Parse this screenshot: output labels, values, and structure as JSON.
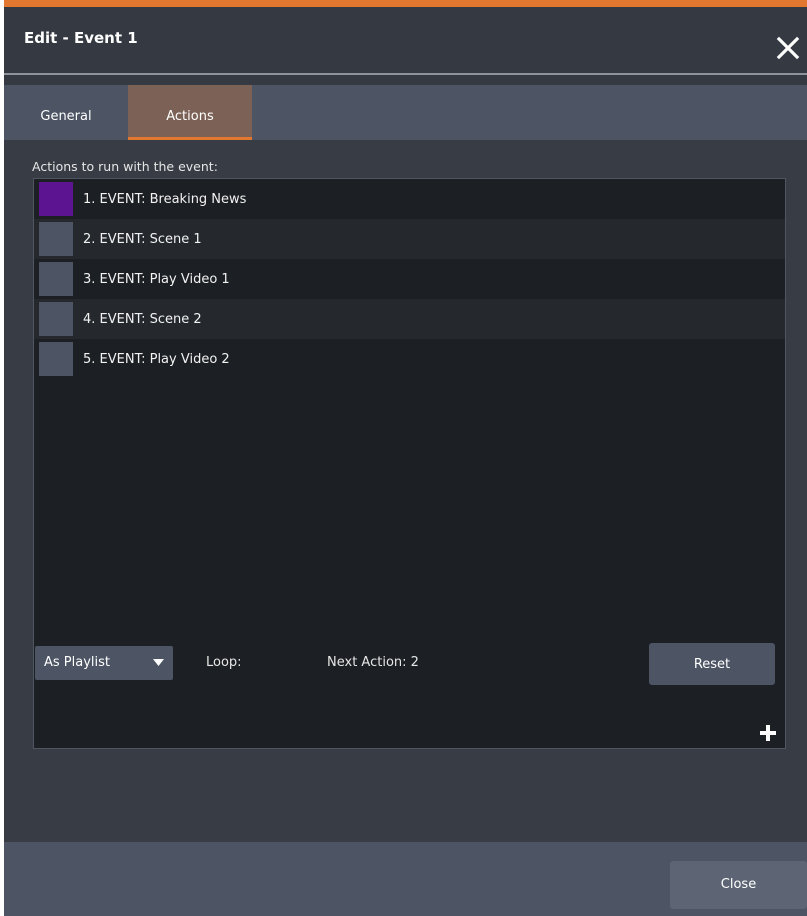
{
  "dialog": {
    "title": "Edit - Event 1",
    "close_icon": "close-x-icon"
  },
  "tabs": [
    {
      "label": "General",
      "active": false
    },
    {
      "label": "Actions",
      "active": true
    }
  ],
  "actions_panel": {
    "label": "Actions to run with the event:",
    "items": [
      {
        "label": "1. EVENT: Breaking News",
        "color": "#5c1490"
      },
      {
        "label": "2. EVENT: Scene 1",
        "color": "#4d5564"
      },
      {
        "label": "3. EVENT: Play Video 1",
        "color": "#4d5564"
      },
      {
        "label": "4. EVENT: Scene 2",
        "color": "#4d5564"
      },
      {
        "label": "5. EVENT: Play Video 2",
        "color": "#4d5564"
      }
    ],
    "add_icon": "plus-icon"
  },
  "controls": {
    "mode_select": {
      "value": "As Playlist"
    },
    "loop_label": "Loop:",
    "loop_checked": false,
    "next_action": "Next Action: 2",
    "reset_label": "Reset"
  },
  "footer": {
    "close_label": "Close"
  },
  "colors": {
    "accent": "#e2782f",
    "panel_bg": "#383d45",
    "tab_active_bg": "#7c6256",
    "selected_swatch": "#5c1490"
  }
}
